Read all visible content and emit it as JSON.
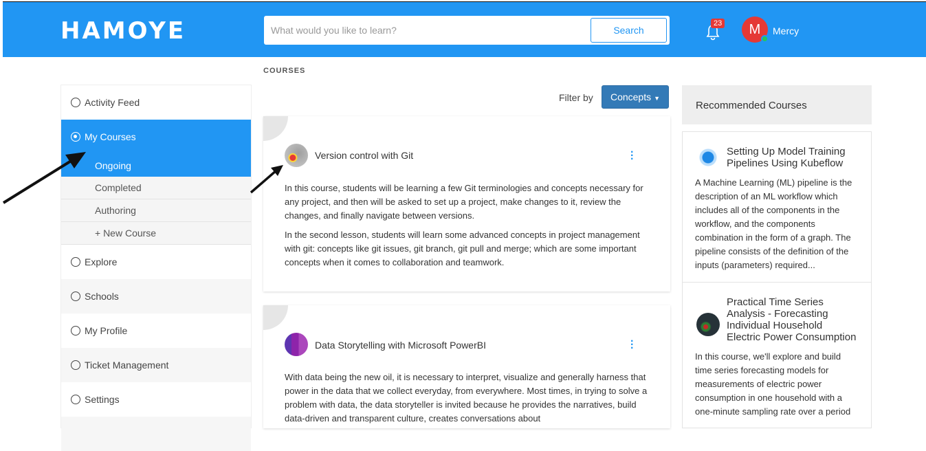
{
  "header": {
    "logo": "HAMOYE",
    "search_placeholder": "What would you like to learn?",
    "search_button": "Search",
    "notification_count": "23",
    "avatar_initial": "M",
    "username": "Mercy"
  },
  "page": {
    "section_label": "COURSES",
    "filter_label": "Filter by",
    "filter_value": "Concepts"
  },
  "sidebar": {
    "items": [
      {
        "label": "Activity Feed"
      },
      {
        "label": "My Courses"
      },
      {
        "label": "Explore"
      },
      {
        "label": "Schools"
      },
      {
        "label": "My Profile"
      },
      {
        "label": "Ticket Management"
      },
      {
        "label": "Settings"
      }
    ],
    "sub_items": [
      {
        "label": "Ongoing"
      },
      {
        "label": "Completed"
      },
      {
        "label": "Authoring"
      },
      {
        "label": "+ New Course"
      }
    ]
  },
  "courses": [
    {
      "title": "Version control with Git",
      "paragraphs": [
        "In this course, students will be learning a few Git terminologies and concepts necessary for any project, and then will be asked to set up a project, make changes to it, review the changes, and finally navigate between versions.",
        "In the second lesson, students will learn some advanced concepts in project management with git: concepts like git issues, git branch, git pull and merge; which are some important concepts when it comes to collaboration and teamwork."
      ]
    },
    {
      "title": "Data Storytelling with Microsoft PowerBI",
      "paragraphs": [
        "With data being the new oil, it is necessary to  interpret, visualize and generally harness that power in the data that we collect everyday, from everywhere. Most times, in trying to solve a problem with data, the data storyteller is invited because he provides the narratives, build data-driven and transparent culture, creates conversations about"
      ]
    }
  ],
  "recommended": {
    "title": "Recommended Courses",
    "items": [
      {
        "title": "Setting Up Model Training Pipelines Using Kubeflow",
        "description": "A Machine Learning (ML) pipeline is the description of an ML workflow which includes all of the components in the workflow, and the components combination in the form of a graph. The pipeline consists of the definition of the inputs (parameters) required..."
      },
      {
        "title": "Practical Time Series Analysis  - Forecasting Individual Household Electric Power Consumption",
        "description": "In this course, we'll explore and build time series forecasting models for measurements of electric power consumption in one household with a one-minute sampling rate over a period"
      }
    ]
  },
  "colors": {
    "primary": "#2196f3",
    "filter_button": "#337ab7",
    "badge": "#e53935"
  }
}
